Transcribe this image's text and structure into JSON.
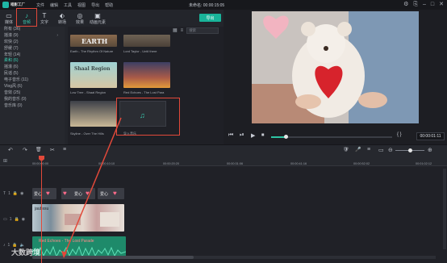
{
  "app": {
    "logo_text": "喵影工厂",
    "title": "未命名: 00:00:15:05"
  },
  "menu": [
    "文件",
    "编辑",
    "工具",
    "视图",
    "导出",
    "帮助"
  ],
  "window_controls": [
    "⚙",
    "⎘",
    "–",
    "□",
    "✕"
  ],
  "media_tabs": [
    {
      "label": "媒体",
      "icon": "folder-icon",
      "glyph": "▭"
    },
    {
      "label": "音频",
      "icon": "music-note-icon",
      "glyph": "♪"
    },
    {
      "label": "文字",
      "icon": "text-icon",
      "glyph": "T"
    },
    {
      "label": "转场",
      "icon": "transition-icon",
      "glyph": "⬖"
    },
    {
      "label": "效果",
      "icon": "effects-icon",
      "glyph": "◎"
    },
    {
      "label": "动画元素",
      "icon": "elements-icon",
      "glyph": "▣"
    }
  ],
  "export_label": "导出",
  "categories": [
    {
      "label": "所有 (36)",
      "arrow": ""
    },
    {
      "label": "摇滚 (9)",
      "arrow": "›"
    },
    {
      "label": "欢快 (2)",
      "arrow": ""
    },
    {
      "label": "舒缓 (7)",
      "arrow": ""
    },
    {
      "label": "年轻 (14)",
      "arrow": ""
    },
    {
      "label": "柔和 (6)",
      "arrow": ""
    },
    {
      "label": "摇滚 (6)",
      "arrow": ""
    },
    {
      "label": "民谣 (5)",
      "arrow": ""
    },
    {
      "label": "电子音乐 (11)",
      "arrow": ""
    },
    {
      "label": "Vlog风 (6)",
      "arrow": ""
    },
    {
      "label": "音效 (25)",
      "arrow": ""
    },
    {
      "label": "我的音乐 (0)",
      "arrow": ""
    },
    {
      "label": "音乐库 (0)",
      "arrow": ""
    }
  ],
  "library": {
    "search_placeholder": "搜索",
    "tracks": [
      {
        "label": "Earth - The Rhythm Of Nature",
        "art_text": "EARTH"
      },
      {
        "label": "Lord Taylor - Until there",
        "art_text": ""
      },
      {
        "label": "Low Tree - Shaal Region",
        "art_text": "Shaal Region"
      },
      {
        "label": "Red Echoes - The Lost Para",
        "art_text": ""
      },
      {
        "label": "Skyline - Over The Hills",
        "art_text": ""
      }
    ],
    "add_tile_label": "导入音乐"
  },
  "preview": {
    "timecode": "00:00:01:11",
    "playback_glyphs": [
      "⏮",
      "⏯",
      "▶",
      "⏹"
    ],
    "progress": 0.12
  },
  "timeline": {
    "toolbar_glyphs": [
      "↶",
      "↷",
      "🗑",
      "✂",
      "≡"
    ],
    "right_glyphs": [
      "🛡",
      "🎤",
      "≡",
      "▭",
      "⊖",
      "⊕"
    ],
    "ruler_ticks": [
      "00:00:00:00",
      "00:00:10:10",
      "00:00:20:20",
      "00:00:31:06",
      "00:00:41:16",
      "00:00:52:02",
      "00:01:02:12"
    ],
    "zoom_level": 0.5,
    "tracks": [
      {
        "index": "1",
        "kind": "text"
      },
      {
        "index": "1",
        "kind": "video"
      },
      {
        "index": "1",
        "kind": "audio"
      }
    ],
    "text_clip_label": "爱心",
    "video_clip_label": "jaubssu",
    "audio_clip_label": "Red Echoes - The Lost Parade"
  },
  "watermark": "大数跨境"
}
